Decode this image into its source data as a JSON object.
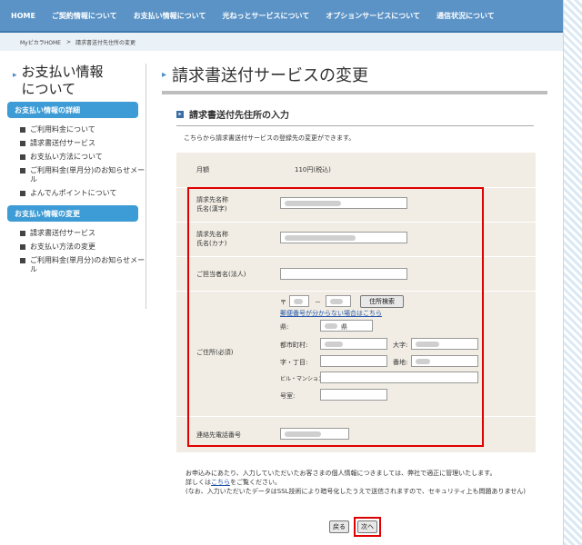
{
  "topnav": [
    "HOME",
    "ご契約情報について",
    "お支払い情報について",
    "光ねっとサービスについて",
    "オプションサービスについて",
    "通信状況について"
  ],
  "breadcrumb": {
    "home": "MyピカラHOME",
    "separator": ">",
    "current": "請求書送付先住所の変更"
  },
  "sidebar": {
    "title_line1": "お支払い情報",
    "title_line2": "について",
    "section1": {
      "heading": "お支払い情報の詳細",
      "items": [
        "ご利用料金について",
        "請求書送付サービス",
        "お支払い方法について",
        "ご利用料金(単月分)のお知らせメール",
        "よんでんポイントについて"
      ]
    },
    "section2": {
      "heading": "お支払い情報の変更",
      "items": [
        "請求書送付サービス",
        "お支払い方法の変更",
        "ご利用料金(単月分)のお知らせメール"
      ]
    }
  },
  "main": {
    "page_title": "請求書送付サービスの変更",
    "section_heading": "請求書送付先住所の入力",
    "intro": "こちらから請求書送付サービスの登録先の変更ができます。",
    "form": {
      "monthly_label": "月額",
      "monthly_value": "110円(税込)",
      "name_kanji_label1": "請求先名称",
      "name_kanji_label2": "氏名(漢字)",
      "name_kana_label1": "請求先名称",
      "name_kana_label2": "氏名(カナ)",
      "contact_label": "ご担当者名(法人)",
      "address_label": "ご住所(必須)",
      "postal_mark": "〒",
      "postal_dash": "－",
      "address_search_button": "住所検索",
      "unknown_postal_link": "郵便番号が分からない場合はこちら",
      "prefecture_label": "県:",
      "prefecture_suffix": "県",
      "city_label": "都市町村:",
      "oaza_label": "大字:",
      "aza_label": "字・丁目:",
      "banchi_label": "番地:",
      "building_label": "ビル・マンション名:",
      "room_label": "号室:",
      "phone_label": "連絡先電話番号"
    },
    "footer_line1": "お申込みにあたり、入力していただいたお客さまの個人情報につきましては、弊社で適正に管理いたします。",
    "footer_line2_pre": "詳しくは",
    "footer_link": "こちら",
    "footer_line2_post": "をご覧ください。",
    "footer_line3": "(なお、入力いただいたデータはSSL技術により暗号化したうえで送信されますので、セキュリティ上も問題ありません)",
    "back_button": "戻る",
    "next_button": "次へ"
  },
  "colors": {
    "nav": "#5b93c6",
    "accent": "#3d9bd5",
    "highlight": "#e00000",
    "form_bg": "#f1ede4"
  }
}
